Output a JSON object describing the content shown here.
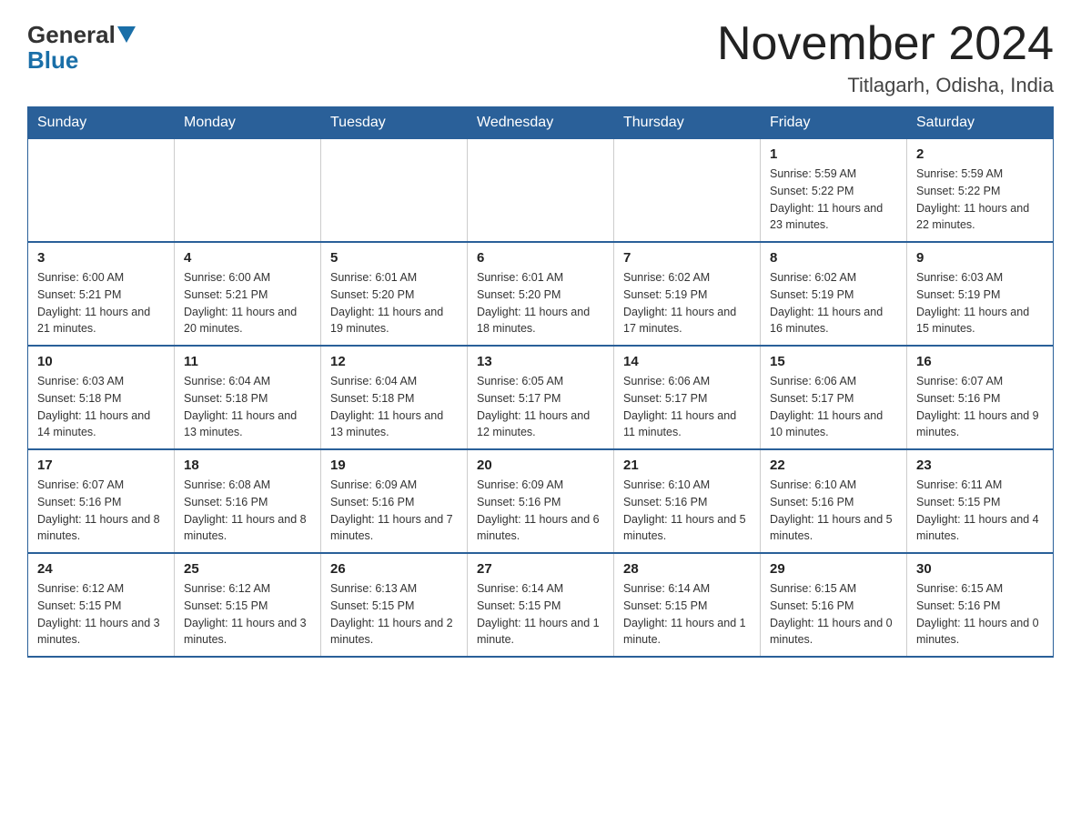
{
  "header": {
    "logo": {
      "general": "General",
      "blue": "Blue"
    },
    "title": "November 2024",
    "location": "Titlagarh, Odisha, India"
  },
  "weekdays": [
    "Sunday",
    "Monday",
    "Tuesday",
    "Wednesday",
    "Thursday",
    "Friday",
    "Saturday"
  ],
  "weeks": [
    [
      {
        "day": "",
        "info": ""
      },
      {
        "day": "",
        "info": ""
      },
      {
        "day": "",
        "info": ""
      },
      {
        "day": "",
        "info": ""
      },
      {
        "day": "",
        "info": ""
      },
      {
        "day": "1",
        "info": "Sunrise: 5:59 AM\nSunset: 5:22 PM\nDaylight: 11 hours and 23 minutes."
      },
      {
        "day": "2",
        "info": "Sunrise: 5:59 AM\nSunset: 5:22 PM\nDaylight: 11 hours and 22 minutes."
      }
    ],
    [
      {
        "day": "3",
        "info": "Sunrise: 6:00 AM\nSunset: 5:21 PM\nDaylight: 11 hours and 21 minutes."
      },
      {
        "day": "4",
        "info": "Sunrise: 6:00 AM\nSunset: 5:21 PM\nDaylight: 11 hours and 20 minutes."
      },
      {
        "day": "5",
        "info": "Sunrise: 6:01 AM\nSunset: 5:20 PM\nDaylight: 11 hours and 19 minutes."
      },
      {
        "day": "6",
        "info": "Sunrise: 6:01 AM\nSunset: 5:20 PM\nDaylight: 11 hours and 18 minutes."
      },
      {
        "day": "7",
        "info": "Sunrise: 6:02 AM\nSunset: 5:19 PM\nDaylight: 11 hours and 17 minutes."
      },
      {
        "day": "8",
        "info": "Sunrise: 6:02 AM\nSunset: 5:19 PM\nDaylight: 11 hours and 16 minutes."
      },
      {
        "day": "9",
        "info": "Sunrise: 6:03 AM\nSunset: 5:19 PM\nDaylight: 11 hours and 15 minutes."
      }
    ],
    [
      {
        "day": "10",
        "info": "Sunrise: 6:03 AM\nSunset: 5:18 PM\nDaylight: 11 hours and 14 minutes."
      },
      {
        "day": "11",
        "info": "Sunrise: 6:04 AM\nSunset: 5:18 PM\nDaylight: 11 hours and 13 minutes."
      },
      {
        "day": "12",
        "info": "Sunrise: 6:04 AM\nSunset: 5:18 PM\nDaylight: 11 hours and 13 minutes."
      },
      {
        "day": "13",
        "info": "Sunrise: 6:05 AM\nSunset: 5:17 PM\nDaylight: 11 hours and 12 minutes."
      },
      {
        "day": "14",
        "info": "Sunrise: 6:06 AM\nSunset: 5:17 PM\nDaylight: 11 hours and 11 minutes."
      },
      {
        "day": "15",
        "info": "Sunrise: 6:06 AM\nSunset: 5:17 PM\nDaylight: 11 hours and 10 minutes."
      },
      {
        "day": "16",
        "info": "Sunrise: 6:07 AM\nSunset: 5:16 PM\nDaylight: 11 hours and 9 minutes."
      }
    ],
    [
      {
        "day": "17",
        "info": "Sunrise: 6:07 AM\nSunset: 5:16 PM\nDaylight: 11 hours and 8 minutes."
      },
      {
        "day": "18",
        "info": "Sunrise: 6:08 AM\nSunset: 5:16 PM\nDaylight: 11 hours and 8 minutes."
      },
      {
        "day": "19",
        "info": "Sunrise: 6:09 AM\nSunset: 5:16 PM\nDaylight: 11 hours and 7 minutes."
      },
      {
        "day": "20",
        "info": "Sunrise: 6:09 AM\nSunset: 5:16 PM\nDaylight: 11 hours and 6 minutes."
      },
      {
        "day": "21",
        "info": "Sunrise: 6:10 AM\nSunset: 5:16 PM\nDaylight: 11 hours and 5 minutes."
      },
      {
        "day": "22",
        "info": "Sunrise: 6:10 AM\nSunset: 5:16 PM\nDaylight: 11 hours and 5 minutes."
      },
      {
        "day": "23",
        "info": "Sunrise: 6:11 AM\nSunset: 5:15 PM\nDaylight: 11 hours and 4 minutes."
      }
    ],
    [
      {
        "day": "24",
        "info": "Sunrise: 6:12 AM\nSunset: 5:15 PM\nDaylight: 11 hours and 3 minutes."
      },
      {
        "day": "25",
        "info": "Sunrise: 6:12 AM\nSunset: 5:15 PM\nDaylight: 11 hours and 3 minutes."
      },
      {
        "day": "26",
        "info": "Sunrise: 6:13 AM\nSunset: 5:15 PM\nDaylight: 11 hours and 2 minutes."
      },
      {
        "day": "27",
        "info": "Sunrise: 6:14 AM\nSunset: 5:15 PM\nDaylight: 11 hours and 1 minute."
      },
      {
        "day": "28",
        "info": "Sunrise: 6:14 AM\nSunset: 5:15 PM\nDaylight: 11 hours and 1 minute."
      },
      {
        "day": "29",
        "info": "Sunrise: 6:15 AM\nSunset: 5:16 PM\nDaylight: 11 hours and 0 minutes."
      },
      {
        "day": "30",
        "info": "Sunrise: 6:15 AM\nSunset: 5:16 PM\nDaylight: 11 hours and 0 minutes."
      }
    ]
  ]
}
